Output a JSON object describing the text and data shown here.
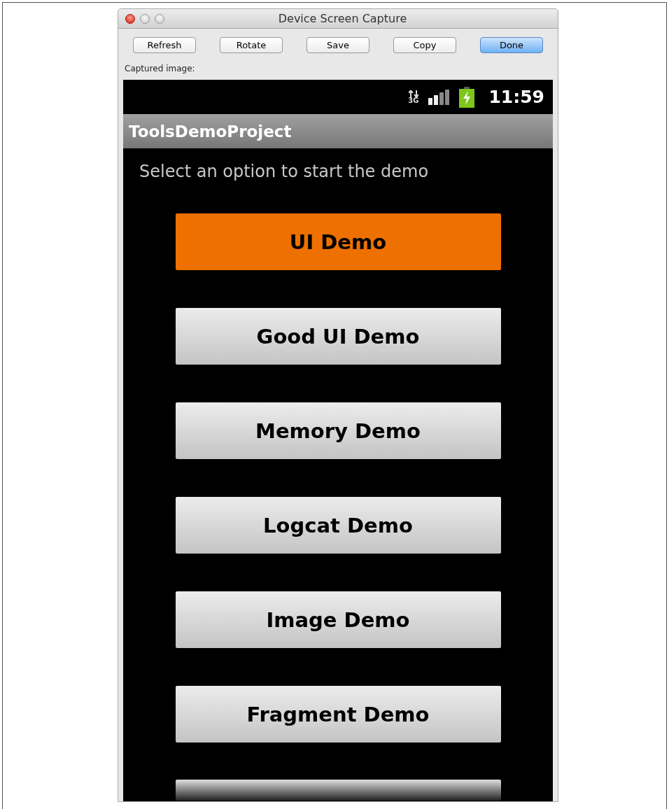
{
  "window": {
    "title": "Device Screen Capture"
  },
  "toolbar": [
    {
      "label": "Refresh",
      "default": false
    },
    {
      "label": "Rotate",
      "default": false
    },
    {
      "label": "Save",
      "default": false
    },
    {
      "label": "Copy",
      "default": false
    },
    {
      "label": "Done",
      "default": true
    }
  ],
  "captured_label": "Captured image:",
  "device": {
    "status_bar": {
      "network": "3G",
      "time": "11:59"
    },
    "app_title": "ToolsDemoProject",
    "prompt": "Select an option to start the demo",
    "buttons": [
      {
        "label": "UI Demo",
        "selected": true
      },
      {
        "label": "Good UI Demo",
        "selected": false
      },
      {
        "label": "Memory Demo",
        "selected": false
      },
      {
        "label": "Logcat Demo",
        "selected": false
      },
      {
        "label": "Image Demo",
        "selected": false
      },
      {
        "label": "Fragment Demo",
        "selected": false
      }
    ],
    "more_below": true
  }
}
